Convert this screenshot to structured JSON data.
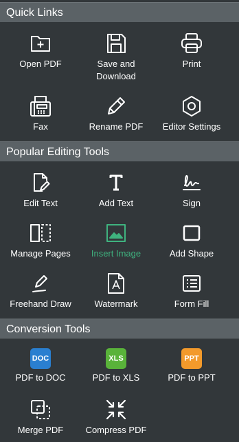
{
  "sections": {
    "quick_links": {
      "title": "Quick Links",
      "items": [
        {
          "label": "Open PDF",
          "icon": "folder-plus-icon"
        },
        {
          "label": "Save and Download",
          "icon": "floppy-disk-icon"
        },
        {
          "label": "Print",
          "icon": "printer-icon"
        },
        {
          "label": "Fax",
          "icon": "fax-icon"
        },
        {
          "label": "Rename PDF",
          "icon": "pencil-icon"
        },
        {
          "label": "Editor Settings",
          "icon": "hexagon-settings-icon"
        }
      ]
    },
    "popular_tools": {
      "title": "Popular Editing Tools",
      "items": [
        {
          "label": "Edit Text",
          "icon": "edit-document-icon"
        },
        {
          "label": "Add Text",
          "icon": "text-t-icon"
        },
        {
          "label": "Sign",
          "icon": "signature-icon"
        },
        {
          "label": "Manage Pages",
          "icon": "pages-icon"
        },
        {
          "label": "Insert Image",
          "icon": "image-icon"
        },
        {
          "label": "Add Shape",
          "icon": "square-shape-icon"
        },
        {
          "label": "Freehand Draw",
          "icon": "pen-draw-icon"
        },
        {
          "label": "Watermark",
          "icon": "watermark-icon"
        },
        {
          "label": "Form Fill",
          "icon": "form-list-icon"
        }
      ]
    },
    "conversion_tools": {
      "title": "Conversion Tools",
      "items": [
        {
          "label": "PDF to DOC",
          "icon": "doc-badge-icon",
          "badge": "DOC",
          "color": "#2a7fd0"
        },
        {
          "label": "PDF to XLS",
          "icon": "xls-badge-icon",
          "badge": "XLS",
          "color": "#59b33a"
        },
        {
          "label": "PDF to PPT",
          "icon": "ppt-badge-icon",
          "badge": "PPT",
          "color": "#f39a2b"
        },
        {
          "label": "Merge PDF",
          "icon": "merge-icon"
        },
        {
          "label": "Compress PDF",
          "icon": "compress-arrows-icon"
        }
      ]
    }
  },
  "colors": {
    "active_label": "#3fb37f",
    "header_bg": "#5b6266",
    "panel_bg": "#32373a"
  }
}
